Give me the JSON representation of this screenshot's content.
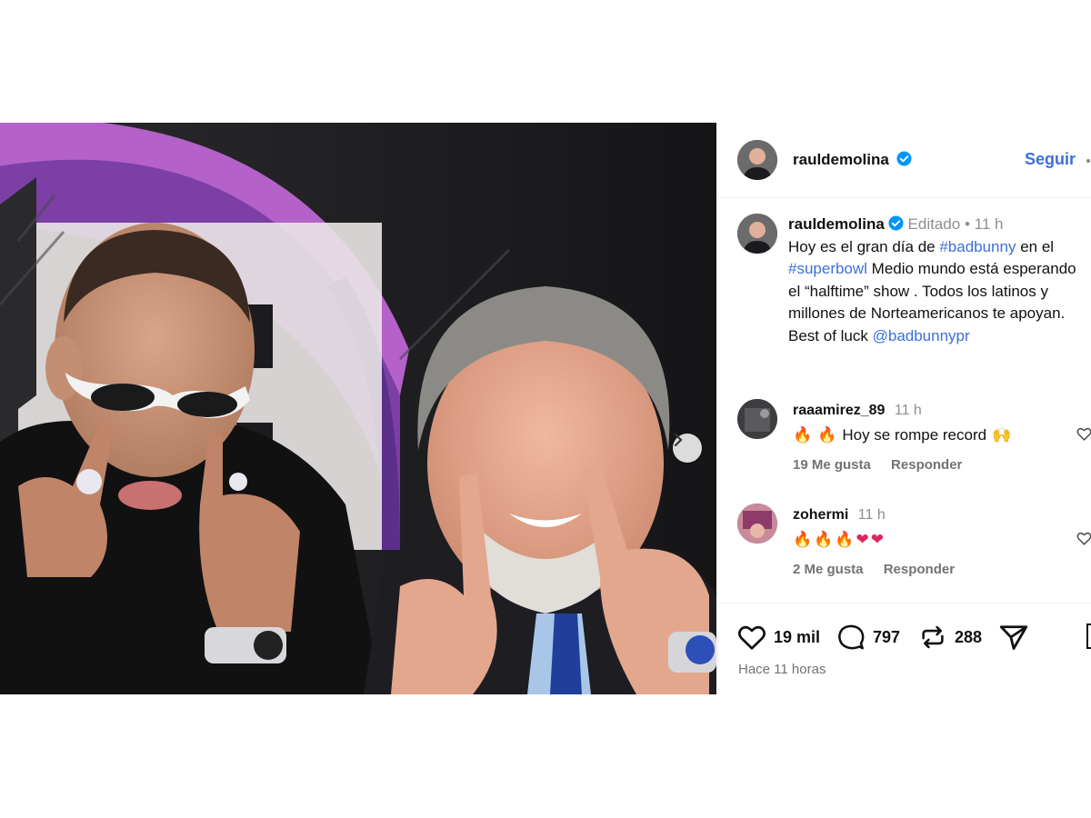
{
  "post": {
    "author": "rauldemolina",
    "follow_label": "Seguir",
    "caption": {
      "edited_label": "Editado",
      "separator": "•",
      "time": "11 h",
      "text_parts": [
        {
          "text": "Hoy es el gran día de ",
          "type": "plain"
        },
        {
          "text": "#badbunny",
          "type": "tag"
        },
        {
          "text": " en el ",
          "type": "plain"
        },
        {
          "text": "#superbowl",
          "type": "tag"
        },
        {
          "text": "  Medio mundo está esperando el “halftime” show . Todos los latinos y millones de Norteamericanos te apoyan.  Best of luck ",
          "type": "plain"
        },
        {
          "text": "@badbunnypr",
          "type": "tag"
        }
      ]
    },
    "comments": [
      {
        "user": "raaamirez_89",
        "time": "11 h",
        "text": "Hoy se rompe record",
        "emoji_prefix": [
          "fire-icon",
          "fire-icon"
        ],
        "emoji_suffix": [
          "raised-hands-icon"
        ],
        "likes_label": "19 Me gusta",
        "reply_label": "Responder"
      },
      {
        "user": "zohermi",
        "time": "11 h",
        "text": "",
        "emoji_prefix": [
          "fire-icon",
          "fire-icon",
          "fire-icon",
          "red-heart-icon",
          "red-heart-icon"
        ],
        "emoji_suffix": [],
        "likes_label": "2 Me gusta",
        "reply_label": "Responder"
      }
    ],
    "stats": {
      "likes": "19 mil",
      "comments": "797",
      "reposts": "288"
    },
    "posted_ago": "Hace 11 horas"
  },
  "colors": {
    "link_blue": "#3b6fd8",
    "verified_blue": "#0095f6",
    "muted": "#737373"
  }
}
